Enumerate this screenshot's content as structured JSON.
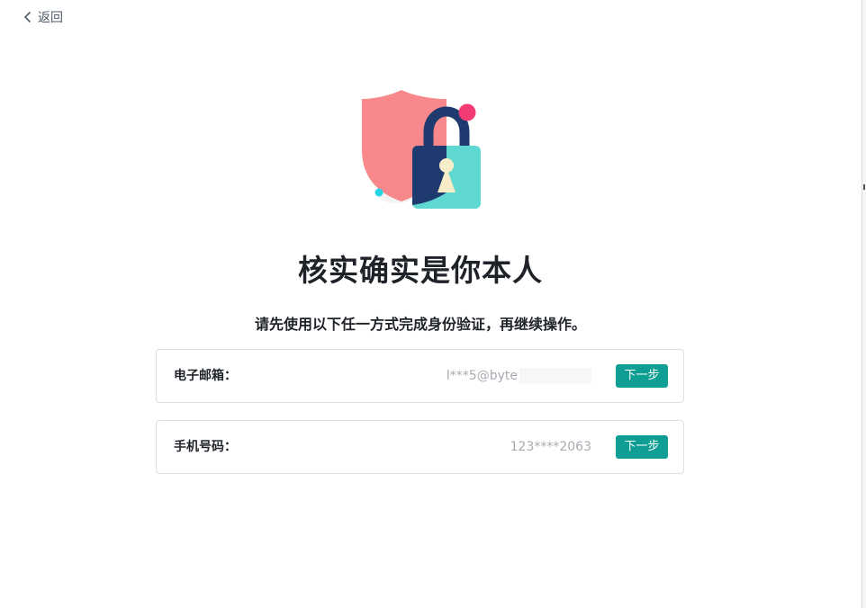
{
  "nav": {
    "back_label": "返回"
  },
  "verify": {
    "title": "核实确实是你本人",
    "subtitle": "请先使用以下任一方式完成身份验证，再继续操作。",
    "options": [
      {
        "label": "电子邮箱：",
        "value": "l***5@byte",
        "button": "下一步"
      },
      {
        "label": "手机号码：",
        "value": "123****2063",
        "button": "下一步"
      }
    ]
  },
  "colors": {
    "accent": "#0e9e93",
    "shield": "#f8888c",
    "lock_body": "#5fd8d2",
    "lock_shackle": "#1e3a6e",
    "pink_dot": "#f43c74",
    "cyan_dot": "#26d4e8",
    "keyhole": "#f9edc9"
  },
  "icons": {
    "back": "chevron-left-icon",
    "illustration": "shield-lock-icon"
  }
}
